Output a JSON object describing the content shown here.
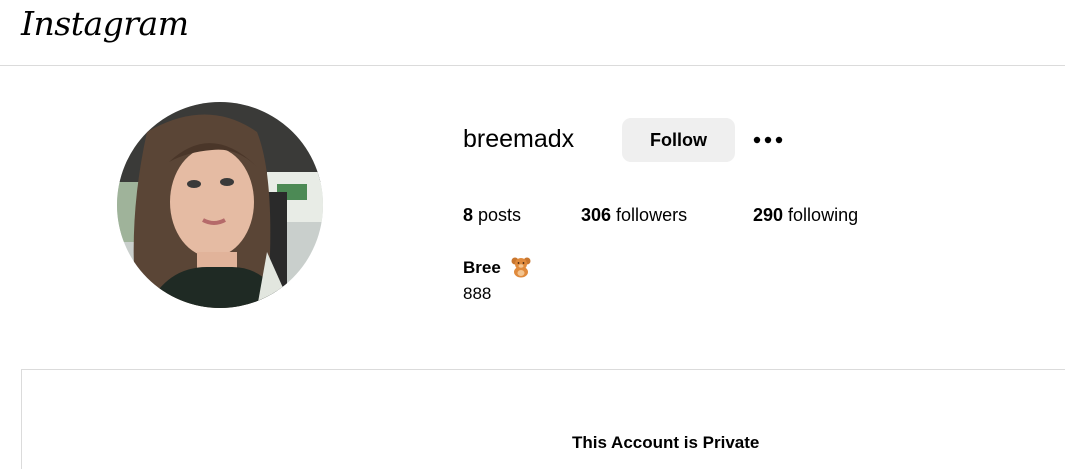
{
  "header": {
    "logo_text": "Instagram"
  },
  "profile": {
    "username": "breemadx",
    "follow_label": "Follow",
    "more_icon": "ellipsis-icon",
    "stats": {
      "posts_count": "8",
      "posts_label": " posts",
      "followers_count": "306",
      "followers_label": " followers",
      "following_count": "290",
      "following_label": " following"
    },
    "bio": {
      "name": "Bree",
      "emoji_icon": "teddy-bear-icon",
      "text": "888"
    }
  },
  "private_notice": {
    "title": "This Account is Private"
  },
  "colors": {
    "border": "#dbdbdb",
    "button_bg": "#efefef",
    "text": "#000000"
  }
}
